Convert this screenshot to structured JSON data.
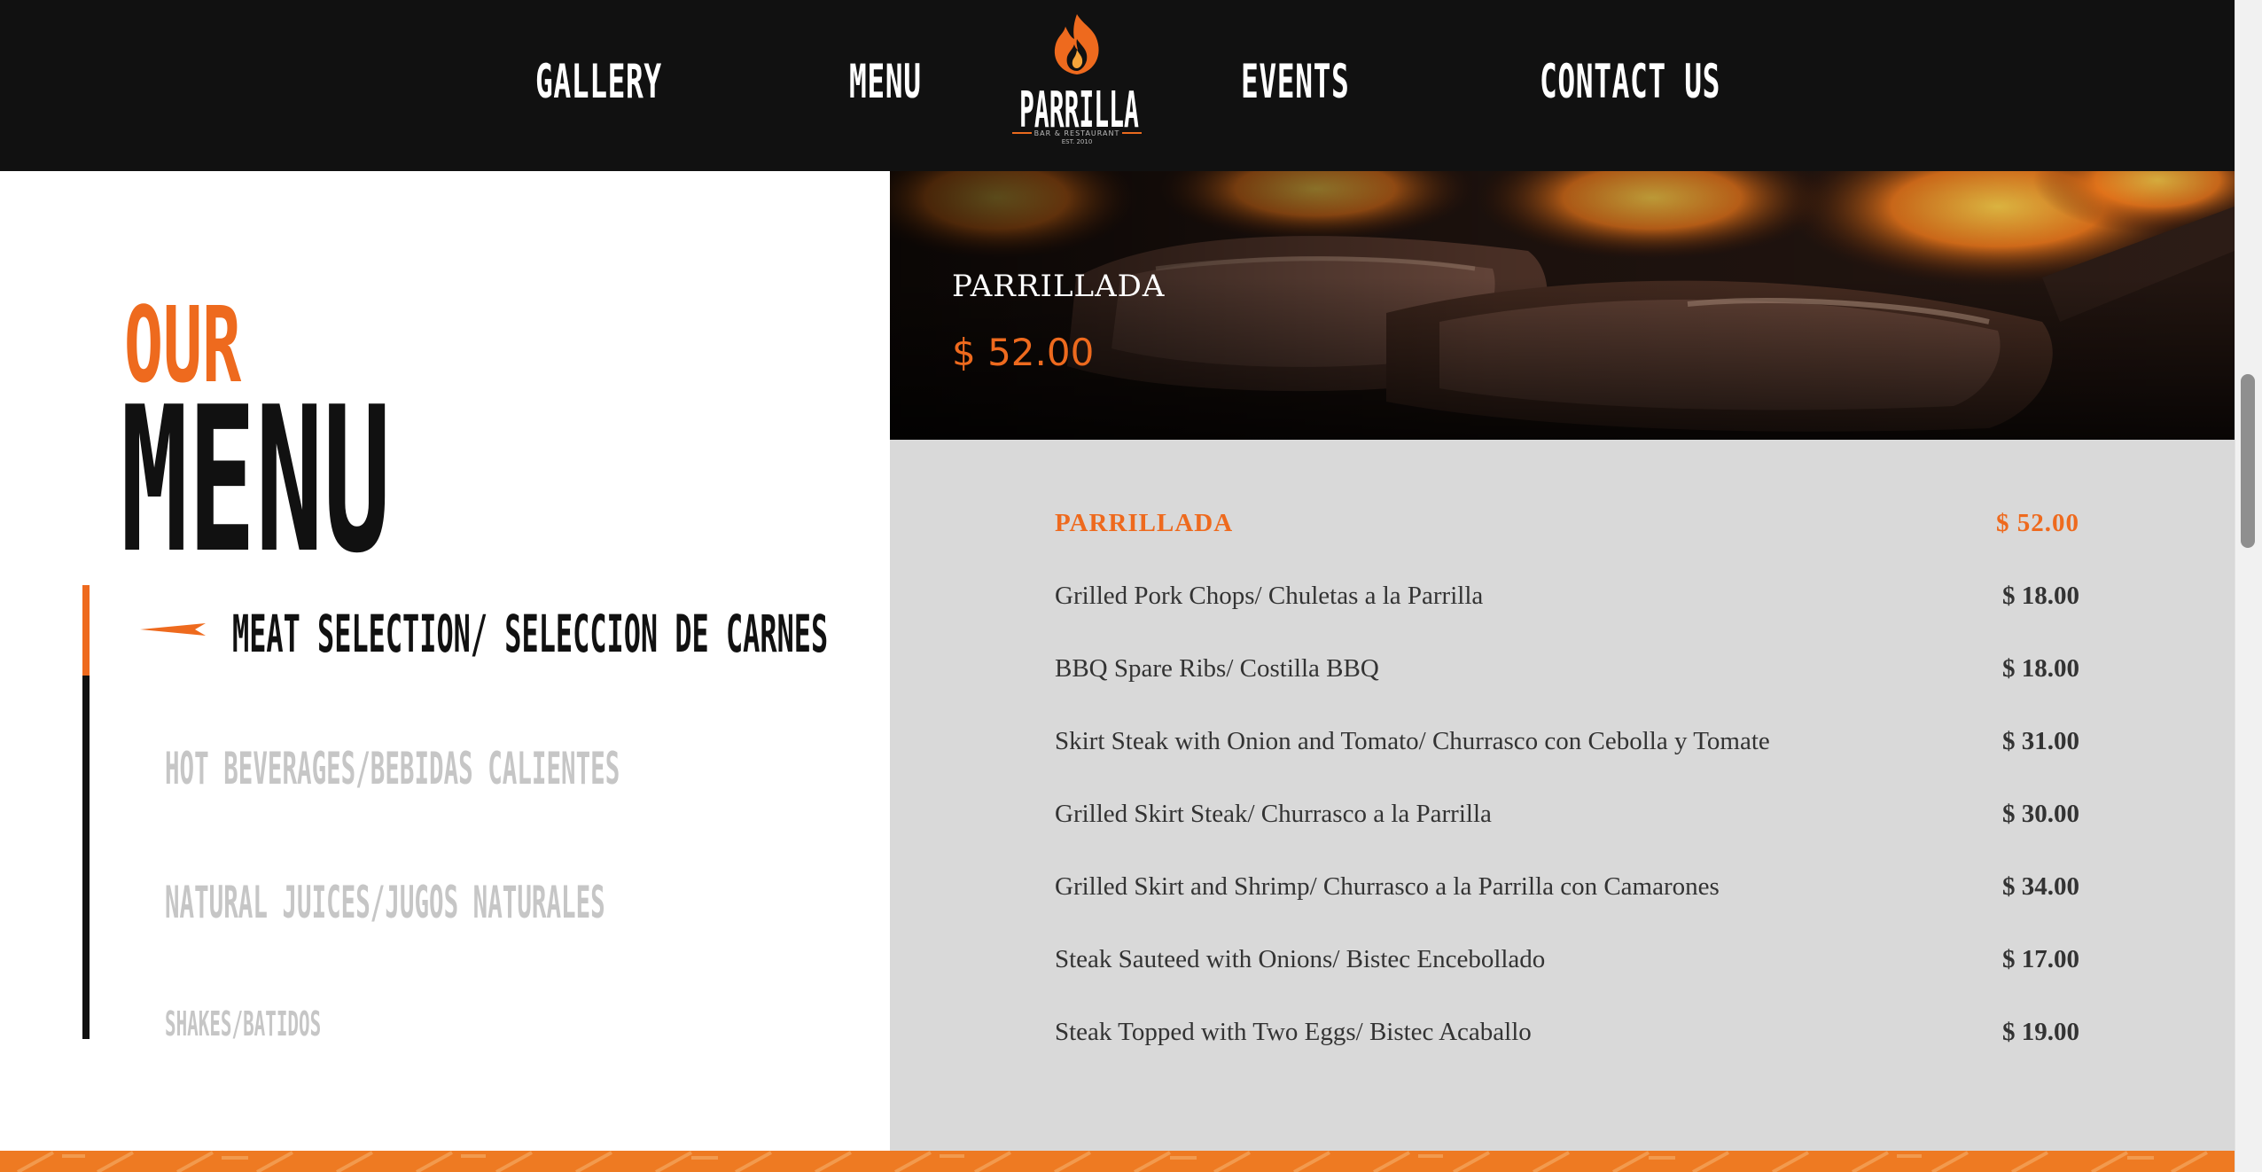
{
  "nav": {
    "gallery": "GALLERY",
    "menu": "MENU",
    "events": "EVENTS",
    "contact": "CONTACT US"
  },
  "logo": {
    "wordmark": "PARRILLA",
    "tagline": "BAR & RESTAURANT",
    "established": "EST. 2010",
    "icon": "flame-icon"
  },
  "intro": {
    "our": "OUR",
    "menu": "MENU"
  },
  "categories": [
    {
      "label": "MEAT SELECTION/ SELECCION DE CARNES",
      "active": true
    },
    {
      "label": "HOT BEVERAGES/BEBIDAS CALIENTES",
      "active": false
    },
    {
      "label": "NATURAL JUICES/JUGOS NATURALES",
      "active": false
    },
    {
      "label": "SHAKES/BATIDOS",
      "active": false
    }
  ],
  "featured": {
    "title": "PARRILLADA",
    "price": "$ 52.00"
  },
  "items": [
    {
      "name": "PARRILLADA",
      "price": "$ 52.00"
    },
    {
      "name": "Grilled Pork Chops/ Chuletas a la Parrilla",
      "price": "$ 18.00"
    },
    {
      "name": "BBQ Spare Ribs/ Costilla BBQ",
      "price": "$ 18.00"
    },
    {
      "name": "Skirt Steak with Onion and Tomato/ Churrasco con Cebolla y Tomate",
      "price": "$ 31.00"
    },
    {
      "name": "Grilled Skirt Steak/ Churrasco a la Parrilla",
      "price": "$ 30.00"
    },
    {
      "name": "Grilled Skirt and Shrimp/ Churrasco a la Parrilla con Camarones",
      "price": "$ 34.00"
    },
    {
      "name": "Steak Sauteed with Onions/ Bistec Encebollado",
      "price": "$ 17.00"
    },
    {
      "name": "Steak Topped with Two Eggs/ Bistec Acaballo",
      "price": "$ 19.00"
    }
  ],
  "colors": {
    "accent": "#ee6a1e",
    "header": "#111111",
    "panel": "#d9d9d9"
  }
}
